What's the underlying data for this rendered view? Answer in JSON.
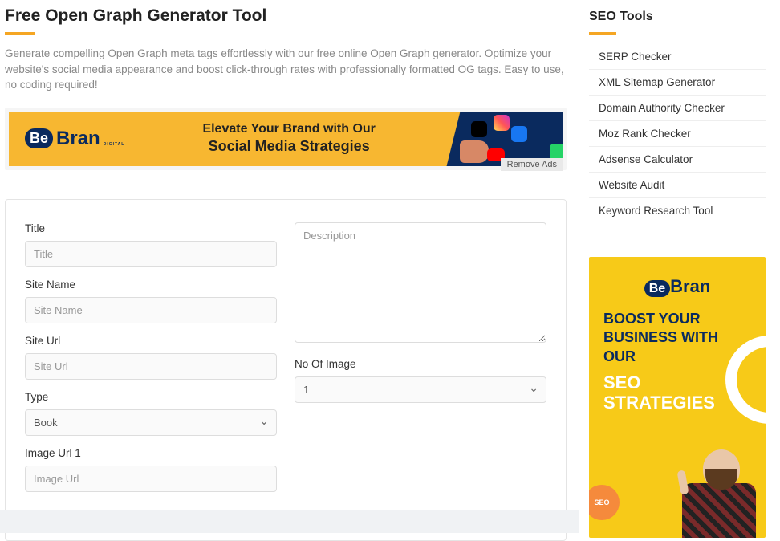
{
  "header": {
    "title": "Free Open Graph Generator Tool",
    "subtitle": "Generate compelling Open Graph meta tags effortlessly with our free online Open Graph generator. Optimize your website's social media appearance and boost click-through rates with professionally formatted OG tags. Easy to use, no coding required!"
  },
  "ad_banner": {
    "logo_be": "Be",
    "logo_bran": "Bran",
    "logo_sub": "DIGITAL",
    "line1": "Elevate Your Brand with Our",
    "line2": "Social Media Strategies",
    "remove_ads": "Remove Ads"
  },
  "form": {
    "title": {
      "label": "Title",
      "placeholder": "Title"
    },
    "site_name": {
      "label": "Site Name",
      "placeholder": "Site Name"
    },
    "site_url": {
      "label": "Site Url",
      "placeholder": "Site Url"
    },
    "type": {
      "label": "Type",
      "value": "Book"
    },
    "image_url": {
      "label": "Image Url 1",
      "placeholder": "Image Url"
    },
    "description": {
      "placeholder": "Description"
    },
    "no_of_image": {
      "label": "No Of Image",
      "value": "1"
    }
  },
  "sidebar": {
    "title": "SEO Tools",
    "items": [
      "SERP Checker",
      "XML Sitemap Generator",
      "Domain Authority Checker",
      "Moz Rank Checker",
      "Adsense Calculator",
      "Website Audit",
      "Keyword Research Tool"
    ]
  },
  "side_ad": {
    "logo_be": "Be",
    "logo_bran": "Bran",
    "boost": "BOOST YOUR BUSINESS WITH OUR",
    "seo": "SEO STRATEGIES"
  }
}
